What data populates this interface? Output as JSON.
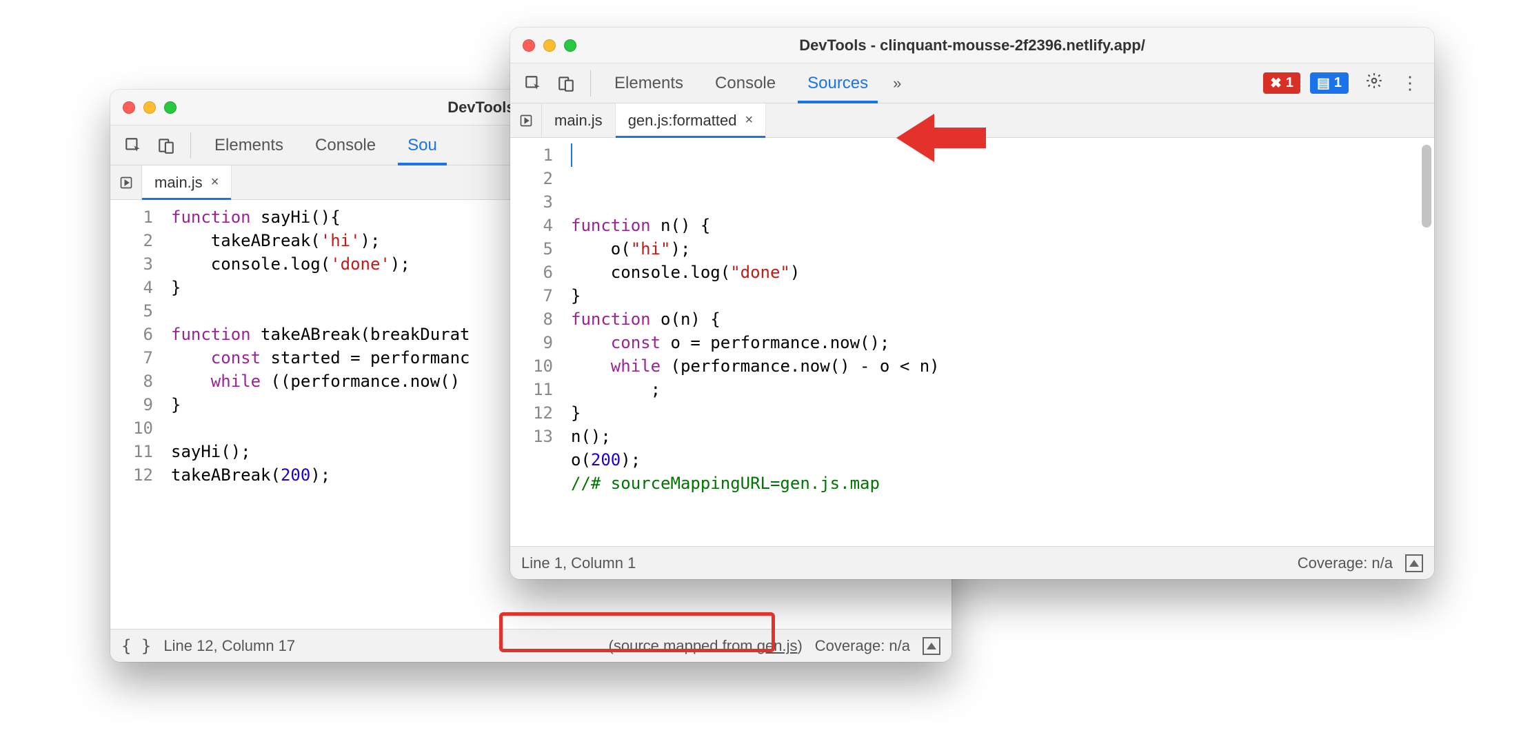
{
  "left_window": {
    "title": "DevTools - clinquant-m",
    "toolbar_tabs": [
      "Elements",
      "Console",
      "Sou"
    ],
    "active_toolbar_tab": 2,
    "file_tabs": [
      {
        "label": "main.js",
        "closeable": true,
        "active": true
      }
    ],
    "code_lines": [
      {
        "n": 1,
        "segments": [
          {
            "t": "function ",
            "c": "kw"
          },
          {
            "t": "sayHi",
            "c": "fn"
          },
          {
            "t": "(){"
          }
        ]
      },
      {
        "n": 2,
        "segments": [
          {
            "t": "    takeABreak("
          },
          {
            "t": "'hi'",
            "c": "str"
          },
          {
            "t": ");"
          }
        ]
      },
      {
        "n": 3,
        "segments": [
          {
            "t": "    console.log("
          },
          {
            "t": "'done'",
            "c": "str"
          },
          {
            "t": ");"
          }
        ]
      },
      {
        "n": 4,
        "segments": [
          {
            "t": "}"
          }
        ]
      },
      {
        "n": 5,
        "segments": []
      },
      {
        "n": 6,
        "segments": [
          {
            "t": "function ",
            "c": "kw"
          },
          {
            "t": "takeABreak",
            "c": "fn"
          },
          {
            "t": "(breakDurat"
          }
        ]
      },
      {
        "n": 7,
        "segments": [
          {
            "t": "    "
          },
          {
            "t": "const ",
            "c": "kw"
          },
          {
            "t": "started = performanc"
          }
        ]
      },
      {
        "n": 8,
        "segments": [
          {
            "t": "    "
          },
          {
            "t": "while ",
            "c": "kw"
          },
          {
            "t": "((performance.now()"
          }
        ]
      },
      {
        "n": 9,
        "segments": [
          {
            "t": "}"
          }
        ]
      },
      {
        "n": 10,
        "segments": []
      },
      {
        "n": 11,
        "segments": [
          {
            "t": "sayHi();"
          }
        ]
      },
      {
        "n": 12,
        "segments": [
          {
            "t": "takeABreak("
          },
          {
            "t": "200",
            "c": "num"
          },
          {
            "t": ");"
          }
        ]
      }
    ],
    "status": {
      "line_col": "Line 12, Column 17",
      "source_mapped_prefix": "(source mapped from ",
      "source_mapped_link": "gen.js",
      "source_mapped_suffix": ")",
      "coverage": "Coverage: n/a"
    }
  },
  "right_window": {
    "title": "DevTools - clinquant-mousse-2f2396.netlify.app/",
    "toolbar_tabs": [
      "Elements",
      "Console",
      "Sources"
    ],
    "active_toolbar_tab": 2,
    "more_indicator": "»",
    "error_count": "1",
    "info_count": "1",
    "file_tabs": [
      {
        "label": "main.js",
        "closeable": false,
        "active": false
      },
      {
        "label": "gen.js:formatted",
        "closeable": true,
        "active": true
      }
    ],
    "code_lines": [
      {
        "n": 1,
        "segments": [
          {
            "t": "function ",
            "c": "kw"
          },
          {
            "t": "n",
            "c": "fn"
          },
          {
            "t": "() {"
          }
        ]
      },
      {
        "n": 2,
        "segments": [
          {
            "t": "    o("
          },
          {
            "t": "\"hi\"",
            "c": "str"
          },
          {
            "t": ");"
          }
        ]
      },
      {
        "n": 3,
        "segments": [
          {
            "t": "    console.log("
          },
          {
            "t": "\"done\"",
            "c": "str"
          },
          {
            "t": ")"
          }
        ]
      },
      {
        "n": 4,
        "segments": [
          {
            "t": "}"
          }
        ]
      },
      {
        "n": 5,
        "segments": [
          {
            "t": "function ",
            "c": "kw"
          },
          {
            "t": "o",
            "c": "fn"
          },
          {
            "t": "(n) {"
          }
        ]
      },
      {
        "n": 6,
        "segments": [
          {
            "t": "    "
          },
          {
            "t": "const ",
            "c": "kw"
          },
          {
            "t": "o = performance.now();"
          }
        ]
      },
      {
        "n": 7,
        "segments": [
          {
            "t": "    "
          },
          {
            "t": "while ",
            "c": "kw"
          },
          {
            "t": "(performance.now() - o < n)"
          }
        ]
      },
      {
        "n": 8,
        "segments": [
          {
            "t": "        ;"
          }
        ]
      },
      {
        "n": 9,
        "segments": [
          {
            "t": "}"
          }
        ]
      },
      {
        "n": 10,
        "segments": [
          {
            "t": "n();"
          }
        ]
      },
      {
        "n": 11,
        "segments": [
          {
            "t": "o("
          },
          {
            "t": "200",
            "c": "num"
          },
          {
            "t": ");"
          }
        ]
      },
      {
        "n": 12,
        "segments": [
          {
            "t": "//# sourceMappingURL=gen.js.map",
            "c": "cmt"
          }
        ]
      },
      {
        "n": 13,
        "segments": []
      }
    ],
    "status": {
      "line_col": "Line 1, Column 1",
      "coverage": "Coverage: n/a"
    }
  },
  "icons": {
    "error_glyph": "✖",
    "info_glyph": "▤"
  }
}
